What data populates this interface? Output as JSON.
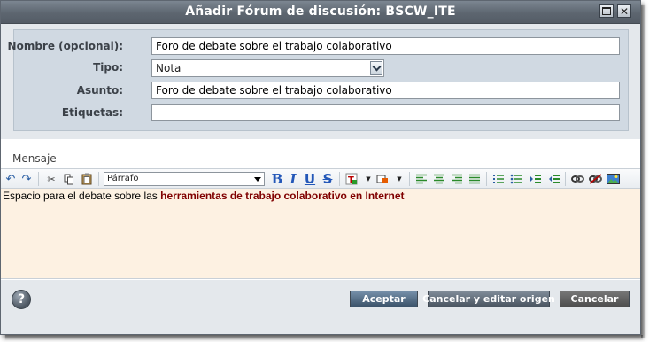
{
  "dialog": {
    "title": "Añadir Fórum de discusión: BSCW_ITE"
  },
  "form": {
    "name_label": "Nombre (opcional):",
    "name_value": "Foro de debate sobre el trabajo colaborativo",
    "type_label": "Tipo:",
    "type_value": "Nota",
    "subject_label": "Asunto:",
    "subject_value": "Foro de debate sobre el trabajo colaborativo",
    "tags_label": "Etiquetas:",
    "tags_value": ""
  },
  "message": {
    "label": "Mensaje",
    "format_value": "Párrafo",
    "text_plain": "Espacio para el debate sobre las ",
    "text_highlight": "herramientas de trabajo colaborativo en Internet"
  },
  "toolbar": {
    "icons": [
      "undo-icon",
      "redo-icon",
      "cut-icon",
      "copy-icon",
      "paste-icon",
      "bold-icon",
      "italic-icon",
      "underline-icon",
      "strikethrough-icon",
      "text-color-icon",
      "highlight-color-icon",
      "align-left-icon",
      "align-center-icon",
      "align-right-icon",
      "align-justify-icon",
      "ordered-list-icon",
      "unordered-list-icon",
      "indent-icon",
      "outdent-icon",
      "link-icon",
      "unlink-icon",
      "image-icon"
    ]
  },
  "buttons": {
    "accept": "Aceptar",
    "cancel_edit": "Cancelar y editar origen",
    "cancel": "Cancelar",
    "help": "?"
  },
  "colors": {
    "title_bar": "#5d6670",
    "form_panel": "#d0d9e2",
    "editor_background": "#fdf1e2",
    "highlight_text": "#800000",
    "accept_button": "#3c536a"
  }
}
